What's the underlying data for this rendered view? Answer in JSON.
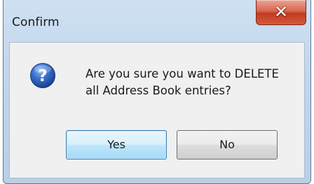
{
  "window": {
    "title": "Confirm",
    "close_icon": "close-icon"
  },
  "dialog": {
    "icon": "question-icon",
    "message_line1": "Are you sure you want to DELETE",
    "message_line2": "all Address Book entries?"
  },
  "buttons": {
    "yes_label": "Yes",
    "no_label": "No"
  },
  "colors": {
    "question_icon": "#2a63c4",
    "default_button_border": "#3c7fb1",
    "close_button": "#c23b22"
  }
}
